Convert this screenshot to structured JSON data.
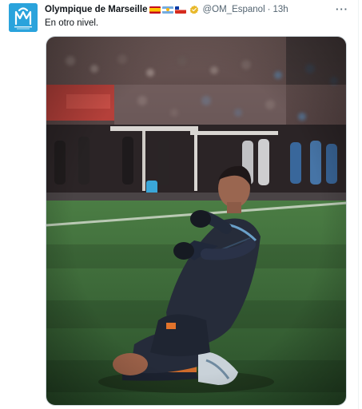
{
  "tweet": {
    "display_name": "Olympique de Marseille",
    "flags": [
      "flag-spain-icon",
      "flag-argentina-icon",
      "flag-chile-icon"
    ],
    "verified_icon": "verified-badge-icon",
    "handle": "@OM_Espanol",
    "separator": "·",
    "time": "13h",
    "more_icon": "more-options-icon",
    "more_label": "···",
    "text": "En otro nivel.",
    "avatar": {
      "icon": "om-logo-icon",
      "background": "#2aa3dc"
    }
  },
  "colors": {
    "secondary_text": "#536471",
    "primary_text": "#0f1419",
    "verified_gold": "#e8b829",
    "pitch_green": "#3d6e3a"
  }
}
